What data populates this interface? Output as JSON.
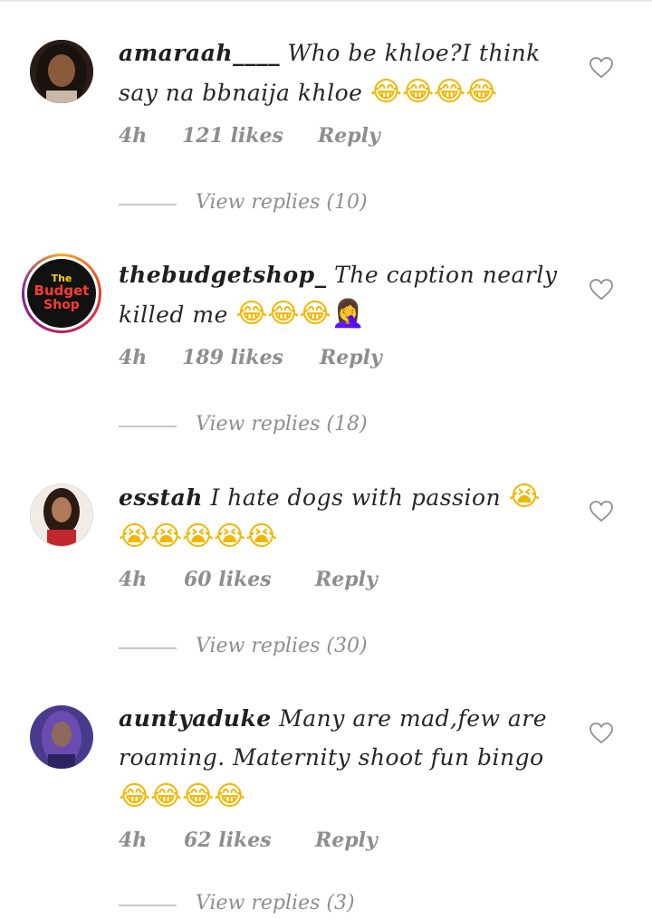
{
  "comments": [
    {
      "username": "amaraah____",
      "text": "Who be khloe?I think say na bbnaija khloe",
      "emojis": "😂😂😂😂",
      "time": "4h",
      "likes": "121 likes",
      "reply": "Reply",
      "view_replies": "View replies (10)"
    },
    {
      "username": "thebudgetshop_",
      "text": "The caption nearly killed me",
      "emojis": "😂😂😂🤦‍♀️",
      "time": "4h",
      "likes": "189 likes",
      "reply": "Reply",
      "view_replies": "View replies (18)",
      "avatar_text": [
        "The",
        "Budget",
        "Shop"
      ]
    },
    {
      "username": "esstah",
      "text": "I hate dogs with passion",
      "emojis": "😭😭😭😭😭😭",
      "time": "4h",
      "likes": "60 likes",
      "reply": "Reply",
      "view_replies": "View replies (30)"
    },
    {
      "username": "auntyaduke",
      "text": "Many are mad,few are roaming. Maternity shoot fun bingo",
      "emojis": "😂😂😂😂",
      "time": "4h",
      "likes": "62 likes",
      "reply": "Reply",
      "view_replies": "View replies (3)"
    }
  ],
  "colors": {
    "text": "#262626",
    "meta": "#8e8e8e",
    "story_ring_start": "#f9a825",
    "story_ring_end": "#c2185b"
  }
}
